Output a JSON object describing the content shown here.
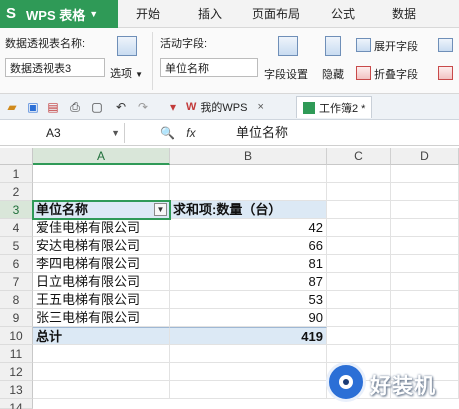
{
  "app": {
    "title": "WPS 表格",
    "logo_glyph": "S",
    "accent": "#2f9a57"
  },
  "menu": {
    "items": [
      "开始",
      "插入",
      "页面布局",
      "公式",
      "数据"
    ]
  },
  "ribbon": {
    "pivot_name_label": "数据透视表名称:",
    "pivot_name_value": "数据透视表3",
    "options_label": "选项",
    "active_field_label": "活动字段:",
    "active_field_value": "单位名称",
    "field_settings_label": "字段设置",
    "hide_label": "隐藏",
    "expand_field_label": "展开字段",
    "collapse_field_label": "折叠字段"
  },
  "tabs": {
    "mywps": "我的WPS",
    "workbook": "工作簿2 *"
  },
  "formula_bar": {
    "cell_ref": "A3",
    "fx": "fx",
    "content": "单位名称"
  },
  "sheet": {
    "columns": [
      "A",
      "B",
      "C",
      "D"
    ],
    "rows": [
      "1",
      "2",
      "3",
      "4",
      "5",
      "6",
      "7",
      "8",
      "9",
      "10",
      "11",
      "12",
      "13",
      "14"
    ],
    "header": {
      "a": "单位名称",
      "b": "求和项:数量（台）"
    },
    "data": [
      {
        "name": "爱佳电梯有限公司",
        "value": "42"
      },
      {
        "name": "安达电梯有限公司",
        "value": "66"
      },
      {
        "name": "李四电梯有限公司",
        "value": "81"
      },
      {
        "name": "日立电梯有限公司",
        "value": "87"
      },
      {
        "name": "王五电梯有限公司",
        "value": "53"
      },
      {
        "name": "张三电梯有限公司",
        "value": "90"
      }
    ],
    "total": {
      "label": "总计",
      "value": "419"
    }
  },
  "watermark": {
    "text": "好装机"
  }
}
